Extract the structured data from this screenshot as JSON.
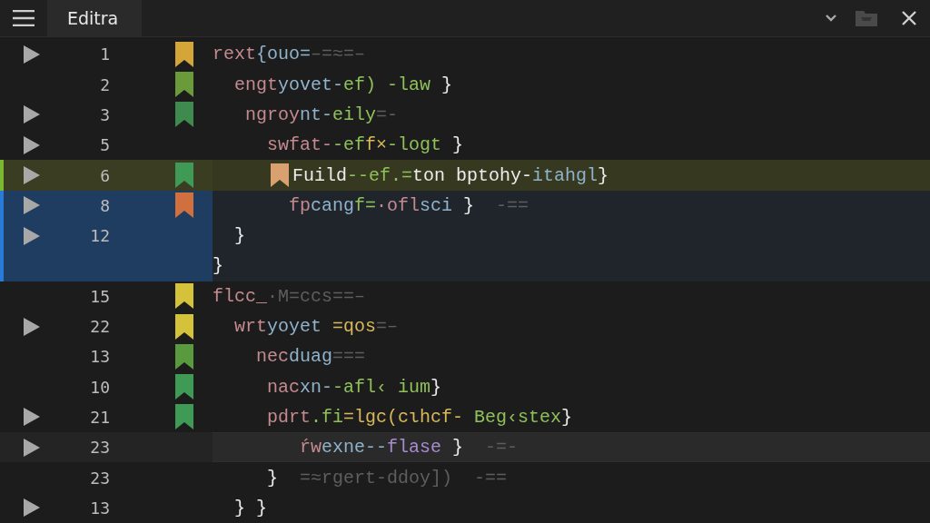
{
  "window": {
    "title": "Editra"
  },
  "rows": [
    {
      "number": "1",
      "fold": true,
      "color": "#d4a63a",
      "current": false,
      "selected": false,
      "hovered": false,
      "tokens": [
        {
          "kind": "kw",
          "text": "rext"
        },
        {
          "kind": "name",
          "text": "{ouo="
        },
        {
          "kind": "faded",
          "text": "–=≈=–"
        }
      ]
    },
    {
      "number": "2",
      "fold": false,
      "color": "#6a9a3a",
      "current": false,
      "selected": false,
      "hovered": false,
      "tokens": [
        {
          "kind": "kw",
          "text": "  engt"
        },
        {
          "kind": "name",
          "text": "yovet-"
        },
        {
          "kind": "val",
          "text": "ef)"
        },
        {
          "kind": "val",
          "text": " -law"
        },
        {
          "kind": "punct",
          "text": " }"
        }
      ]
    },
    {
      "number": "3",
      "fold": true,
      "color": "#3f8a4e",
      "current": false,
      "selected": false,
      "hovered": false,
      "tokens": [
        {
          "kind": "kw",
          "text": "   ngroy"
        },
        {
          "kind": "name",
          "text": "nt-"
        },
        {
          "kind": "val",
          "text": "eily"
        },
        {
          "kind": "faded",
          "text": "=-"
        }
      ]
    },
    {
      "number": "5",
      "fold": true,
      "current": false,
      "selected": false,
      "hovered": false,
      "tokens": [
        {
          "kind": "kw",
          "text": "     swfat-"
        },
        {
          "kind": "val",
          "text": "-ef"
        },
        {
          "kind": "str",
          "text": "f×"
        },
        {
          "kind": "val",
          "text": "-logt"
        },
        {
          "kind": "punct",
          "text": " }"
        }
      ]
    },
    {
      "number": "6",
      "fold": true,
      "color": "#3f9a55",
      "current": true,
      "selected": false,
      "hovered": false,
      "inline_bookmark": true,
      "tokens": [
        {
          "kind": "plain",
          "text": "Fuild"
        },
        {
          "kind": "val",
          "text": "--ef.="
        },
        {
          "kind": "plain",
          "text": "ton bptohy-"
        },
        {
          "kind": "name",
          "text": "itahgl"
        },
        {
          "kind": "punct",
          "text": "}"
        }
      ]
    },
    {
      "number": "8",
      "fold": true,
      "color": "#d0703f",
      "current": false,
      "selected": true,
      "hovered": false,
      "tokens": [
        {
          "kind": "kw",
          "text": "       fp"
        },
        {
          "kind": "name",
          "text": "cang"
        },
        {
          "kind": "val",
          "text": "f="
        },
        {
          "kind": "kw",
          "text": "·ofl"
        },
        {
          "kind": "name",
          "text": "sci"
        },
        {
          "kind": "punct",
          "text": " }"
        },
        {
          "kind": "faded",
          "text": "  -=="
        }
      ]
    },
    {
      "number": "12",
      "fold": true,
      "current": false,
      "selected": true,
      "hovered": false,
      "tokens": [
        {
          "kind": "punct",
          "text": "  }"
        }
      ]
    },
    {
      "fold": false,
      "current": false,
      "selected": true,
      "hovered": false,
      "tokens": [
        {
          "kind": "punct",
          "text": "}"
        }
      ]
    },
    {
      "number": "15",
      "fold": false,
      "color": "#d4c23a",
      "current": false,
      "selected": false,
      "hovered": false,
      "tokens": [
        {
          "kind": "kw",
          "text": "flcc_"
        },
        {
          "kind": "faded",
          "text": "·M=ccs==–"
        }
      ]
    },
    {
      "number": "22",
      "fold": true,
      "color": "#d4c23a",
      "current": false,
      "selected": false,
      "hovered": false,
      "tokens": [
        {
          "kind": "kw",
          "text": "  wrt"
        },
        {
          "kind": "name",
          "text": "yoyet "
        },
        {
          "kind": "str",
          "text": "=qos"
        },
        {
          "kind": "faded",
          "text": "=–"
        }
      ]
    },
    {
      "number": "13",
      "fold": false,
      "color": "#5a9a3f",
      "current": false,
      "selected": false,
      "hovered": false,
      "tokens": [
        {
          "kind": "kw",
          "text": "    nec"
        },
        {
          "kind": "name",
          "text": "duag"
        },
        {
          "kind": "faded",
          "text": "==="
        }
      ]
    },
    {
      "number": "10",
      "fold": false,
      "color": "#3f9a55",
      "current": false,
      "selected": false,
      "hovered": false,
      "tokens": [
        {
          "kind": "kw",
          "text": "     nac"
        },
        {
          "kind": "name",
          "text": "xn-"
        },
        {
          "kind": "val",
          "text": "-afl‹ ium"
        },
        {
          "kind": "punct",
          "text": "}"
        }
      ]
    },
    {
      "number": "21",
      "fold": true,
      "color": "#3f9a55",
      "current": false,
      "selected": false,
      "hovered": false,
      "tokens": [
        {
          "kind": "kw",
          "text": "     pdrt"
        },
        {
          "kind": "val",
          "text": ".fi"
        },
        {
          "kind": "str",
          "text": "=lgc(cιhcf-"
        },
        {
          "kind": "val",
          "text": " Beg‹stex"
        },
        {
          "kind": "punct",
          "text": "}"
        }
      ]
    },
    {
      "number": "23",
      "fold": true,
      "current": false,
      "selected": false,
      "hovered": true,
      "tokens": [
        {
          "kind": "kw",
          "text": "        ŕw"
        },
        {
          "kind": "name",
          "text": "exne--"
        },
        {
          "kind": "enum",
          "text": "flase"
        },
        {
          "kind": "punct",
          "text": " }"
        },
        {
          "kind": "faded",
          "text": "  -=-"
        }
      ]
    },
    {
      "number": "23",
      "fold": false,
      "current": false,
      "selected": false,
      "hovered": false,
      "tokens": [
        {
          "kind": "punct",
          "text": "     }"
        },
        {
          "kind": "faded",
          "text": "  =≈rgert-ddoy])  -=="
        }
      ]
    },
    {
      "number": "13",
      "fold": true,
      "current": false,
      "selected": false,
      "hovered": false,
      "tokens": [
        {
          "kind": "punct",
          "text": "  } }"
        }
      ]
    }
  ]
}
